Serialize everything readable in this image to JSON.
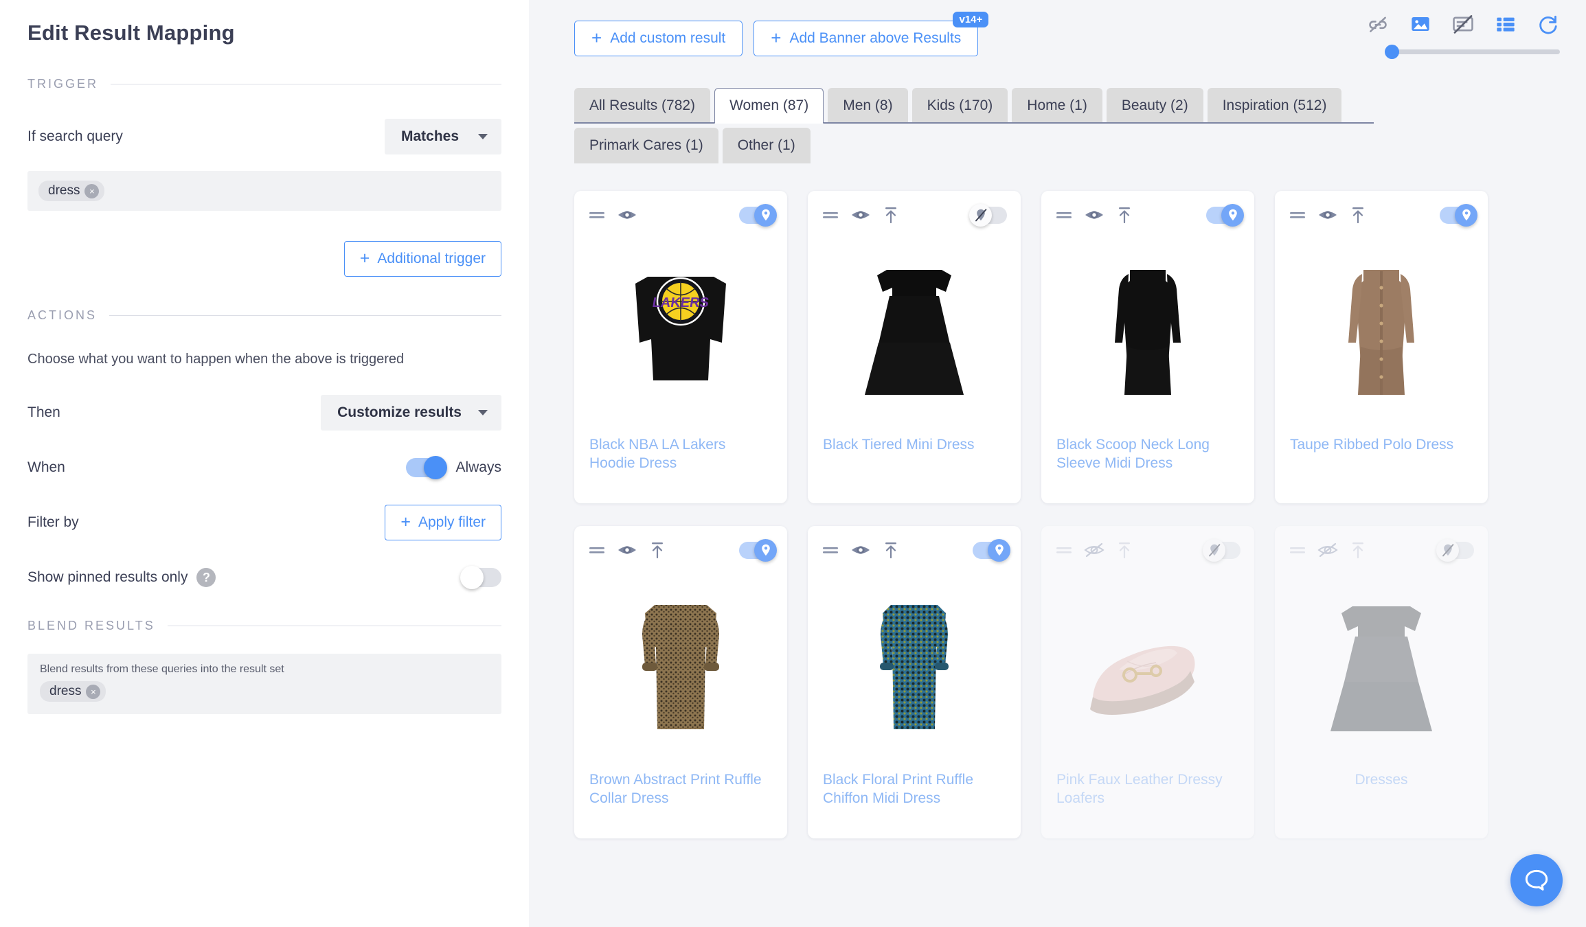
{
  "sidebar": {
    "title": "Edit Result Mapping",
    "trigger_section": "TRIGGER",
    "if_search_query_label": "If search query",
    "match_mode": "Matches",
    "trigger_chip": "dress",
    "additional_trigger_label": "Additional trigger",
    "actions_section": "ACTIONS",
    "actions_helper": "Choose what you want to happen when the above is triggered",
    "then_label": "Then",
    "then_value": "Customize results",
    "when_label": "When",
    "when_value": "Always",
    "filter_by_label": "Filter by",
    "apply_filter_label": "Apply filter",
    "show_pinned_label": "Show pinned results only",
    "help_glyph": "?",
    "blend_section": "BLEND RESULTS",
    "blend_helper": "Blend results from these queries into the result set",
    "blend_chip": "dress",
    "chip_remove_glyph": "×",
    "plus_glyph": "+",
    "show_pinned_state": "off",
    "when_state": "on"
  },
  "toolbar": {
    "add_custom_result": "Add custom result",
    "add_banner": "Add Banner above Results",
    "banner_badge": "v14+",
    "plus_glyph": "+",
    "icons": [
      {
        "name": "broken-link-icon",
        "state": "disabled"
      },
      {
        "name": "image-icon",
        "state": "active"
      },
      {
        "name": "hide-text-icon",
        "state": "disabled"
      },
      {
        "name": "list-view-icon",
        "state": "active"
      },
      {
        "name": "refresh-icon",
        "state": "active"
      }
    ],
    "zoom_slider_value": 0
  },
  "tabs": {
    "row1": [
      {
        "label": "All Results (782)",
        "active": false
      },
      {
        "label": "Women (87)",
        "active": true
      },
      {
        "label": "Men (8)",
        "active": false
      },
      {
        "label": "Kids (170)",
        "active": false
      },
      {
        "label": "Home (1)",
        "active": false
      },
      {
        "label": "Beauty (2)",
        "active": false
      },
      {
        "label": "Inspiration (512)",
        "active": false
      }
    ],
    "row2": [
      {
        "label": "Primark Cares (1)",
        "active": false
      },
      {
        "label": "Other (1)",
        "active": false
      }
    ]
  },
  "results": [
    {
      "title": "Black NBA LA Lakers Hoodie Dress",
      "visible": true,
      "pinned": true,
      "has_move_top": false,
      "image": "lakers-hoodie",
      "centered": false
    },
    {
      "title": "Black Tiered Mini Dress",
      "visible": true,
      "pinned": false,
      "has_move_top": true,
      "image": "black-tiered-dress",
      "centered": false
    },
    {
      "title": "Black Scoop Neck Long Sleeve Midi Dress",
      "visible": true,
      "pinned": true,
      "has_move_top": true,
      "image": "black-midi-dress",
      "centered": false
    },
    {
      "title": "Taupe Ribbed Polo Dress",
      "visible": true,
      "pinned": true,
      "has_move_top": true,
      "image": "taupe-polo-dress",
      "centered": false
    },
    {
      "title": "Brown Abstract Print Ruffle Collar Dress",
      "visible": true,
      "pinned": true,
      "has_move_top": true,
      "image": "brown-print-dress",
      "centered": false
    },
    {
      "title": "Black Floral Print Ruffle Chiffon Midi Dress",
      "visible": true,
      "pinned": true,
      "has_move_top": true,
      "image": "blue-floral-dress",
      "centered": false
    },
    {
      "title": "Pink Faux Leather Dressy Loafers",
      "visible": false,
      "pinned": false,
      "has_move_top": true,
      "image": "pink-loafer",
      "centered": false
    },
    {
      "title": "Dresses",
      "visible": false,
      "pinned": false,
      "has_move_top": true,
      "image": "grey-tiered-dress",
      "centered": true
    }
  ],
  "colors": {
    "accent": "#4a90f7",
    "title_link": "#8fb8f5",
    "panel_bg": "#f4f5f8",
    "tab_inactive": "#dcdcdc",
    "text_dark": "#3b3f55"
  },
  "chat_button": {
    "name": "chat-bubble"
  }
}
